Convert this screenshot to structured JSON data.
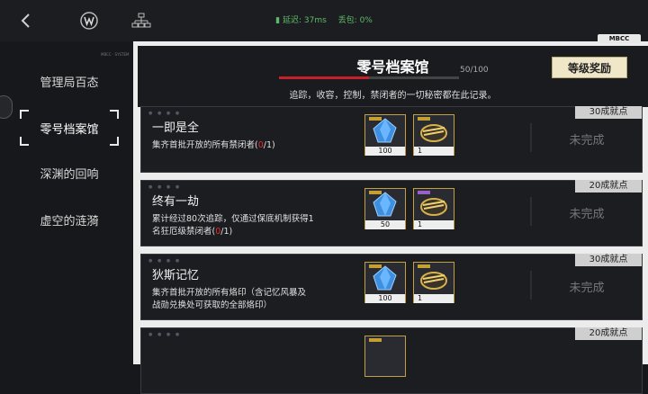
{
  "topbar": {
    "icons": [
      "back-arrow-icon",
      "emblem-w-icon",
      "hierarchy-icon"
    ],
    "latency_label": "延迟: 37ms",
    "packet_loss_label": "丢包: 0%",
    "colors": {
      "status": "#5fb96a"
    }
  },
  "sidebar": {
    "tiny_label": "MBCC · SYSTEM",
    "items": [
      {
        "label": "管理局百态"
      },
      {
        "label": "零号档案馆",
        "active": true
      },
      {
        "label": "深渊的回响"
      },
      {
        "label": "虚空的涟漪"
      }
    ]
  },
  "panel": {
    "tag": "MBCC",
    "title": "零号档案馆",
    "progress_text": "50/100",
    "progress_value": 0.5,
    "reward_button": "等级奖励",
    "subtitle": "追踪，收容，控制，禁闭者的一切秘密都在此记录。"
  },
  "achievements": [
    {
      "title": "一即是全",
      "desc_prefix": "集齐首批开放的所有禁闭者(",
      "count": "0",
      "desc_suffix": "/1)",
      "items": [
        {
          "icon": "blue-crystal-icon",
          "count": "100"
        },
        {
          "icon": "gold-gear-icon",
          "count": "1"
        }
      ],
      "points": "30成就点",
      "state": "未完成"
    },
    {
      "title": "终有一劫",
      "desc_prefix": "累计经过80次追踪，仅通过保底机制获得1名狂厄级禁闭者(",
      "count": "0",
      "desc_suffix": "/1)",
      "items": [
        {
          "icon": "blue-crystal-icon",
          "count": "50"
        },
        {
          "icon": "gold-gear-icon",
          "count": "1"
        }
      ],
      "points": "20成就点",
      "state": "未完成"
    },
    {
      "title": "狄斯记忆",
      "desc_prefix": "集齐首批开放的所有烙印（含记忆风暴及战勋兑换处可获取的全部烙印）",
      "count": "",
      "desc_suffix": "",
      "items": [
        {
          "icon": "blue-crystal-icon",
          "count": "100"
        },
        {
          "icon": "gold-gear-icon",
          "count": "1"
        }
      ],
      "points": "30成就点",
      "state": "未完成"
    },
    {
      "points": "20成就点"
    }
  ]
}
